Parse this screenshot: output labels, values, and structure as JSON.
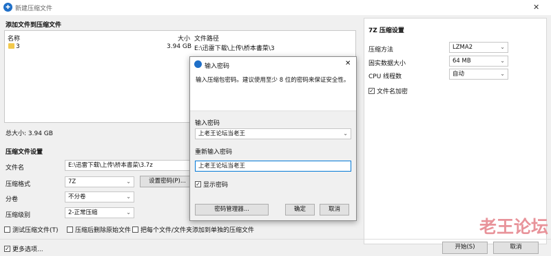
{
  "window": {
    "title": "新建压缩文件",
    "close_glyph": "✕"
  },
  "files_section": {
    "heading": "添加文件到压缩文件",
    "columns": [
      "名称",
      "大小",
      "文件路径"
    ],
    "rows": [
      {
        "name": "3",
        "size": "3.94 GB",
        "path": "E:\\迅雷下载\\上传\\桥本書菜\\3"
      }
    ],
    "total_size": "总大小: 3.94 GB"
  },
  "settings": {
    "heading": "压缩文件设置",
    "filename_label": "文件名",
    "filename_value": "E:\\迅雷下载\\上传\\桥本書菜\\3.7z",
    "format_label": "压缩格式",
    "format_value": "7Z",
    "set_password_button": "设置密码(P)...",
    "volume_label": "分卷",
    "volume_value": "不分卷",
    "level_label": "压缩级别",
    "level_value": "2-正常压缩",
    "options": [
      {
        "label": "测试压缩文件(T)",
        "checked": false
      },
      {
        "label": "压缩后删除原始文件",
        "checked": false
      },
      {
        "label": "把每个文件/文件夹添加到单独的压缩文件",
        "checked": false
      }
    ],
    "more_options": "更多选项...",
    "more_options_checked": true
  },
  "seven_zip": {
    "heading": "7Z 压缩设置",
    "method_label": "压缩方法",
    "method_value": "LZMA2",
    "dict_label": "固实数据大小",
    "dict_value": "64 MB",
    "threads_label": "CPU 线程数",
    "threads_value": "自动",
    "encrypt_names_label": "文件名加密",
    "encrypt_names_checked": true
  },
  "footer": {
    "start_button": "开始(S)",
    "cancel_button": "取消"
  },
  "password_dialog": {
    "title": "输入密码",
    "close_glyph": "✕",
    "instruction": "输入压缩包密码。建议使用至少 8 位的密码来保证安全性。",
    "password_label": "输入密码",
    "password_value": "上老王论坛当老王",
    "confirm_label": "重新输入密码",
    "confirm_value": "上老王论坛当老王",
    "show_password_label": "显示密码",
    "show_password_checked": true,
    "manager_button": "密码管理器...",
    "ok_button": "确定",
    "cancel_button": "取消"
  },
  "watermark": {
    "text": "老王论坛",
    "color": "#e8939a"
  },
  "colors": {
    "accent": "#1f6fc8",
    "focus_border": "#0078d7"
  }
}
